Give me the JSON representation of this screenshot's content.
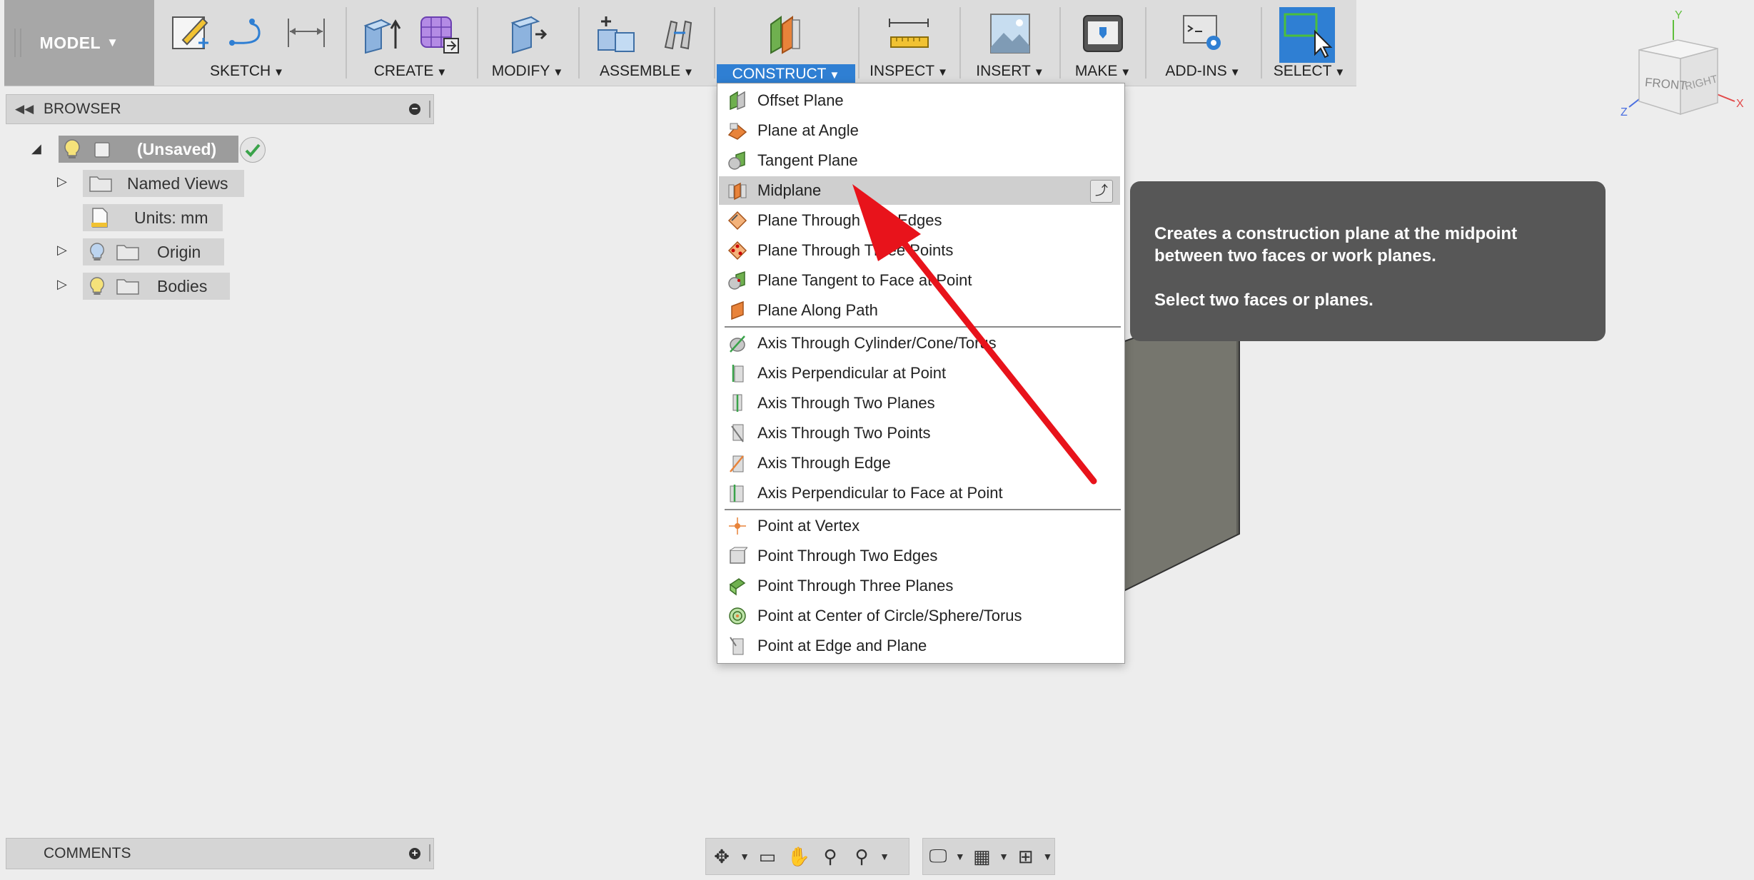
{
  "toolbar": {
    "model_label": "MODEL",
    "groups": [
      {
        "label": "SKETCH"
      },
      {
        "label": "CREATE"
      },
      {
        "label": "MODIFY"
      },
      {
        "label": "ASSEMBLE"
      },
      {
        "label": "CONSTRUCT"
      },
      {
        "label": "INSPECT"
      },
      {
        "label": "INSERT"
      },
      {
        "label": "MAKE"
      },
      {
        "label": "ADD-INS"
      },
      {
        "label": "SELECT"
      }
    ],
    "caret": "▼"
  },
  "browser": {
    "title": "BROWSER",
    "root": "(Unsaved)",
    "items": [
      {
        "label": "Named Views"
      },
      {
        "label": "Units: mm"
      },
      {
        "label": "Origin"
      },
      {
        "label": "Bodies"
      }
    ]
  },
  "construct_menu": {
    "items": [
      {
        "label": "Offset Plane",
        "icon": "offset-plane-icon"
      },
      {
        "label": "Plane at Angle",
        "icon": "plane-at-angle-icon"
      },
      {
        "label": "Tangent Plane",
        "icon": "tangent-plane-icon"
      },
      {
        "label": "Midplane",
        "icon": "midplane-icon",
        "highlighted": true
      },
      {
        "label": "Plane Through Two Edges",
        "icon": "plane-two-edges-icon"
      },
      {
        "label": "Plane Through Three Points",
        "icon": "plane-three-points-icon"
      },
      {
        "label": "Plane Tangent to Face at Point",
        "icon": "plane-tangent-face-icon"
      },
      {
        "label": "Plane Along Path",
        "icon": "plane-along-path-icon"
      },
      {
        "label": "Axis Through Cylinder/Cone/Torus",
        "icon": "axis-cylinder-icon"
      },
      {
        "label": "Axis Perpendicular at Point",
        "icon": "axis-perpendicular-point-icon"
      },
      {
        "label": "Axis Through Two Planes",
        "icon": "axis-two-planes-icon"
      },
      {
        "label": "Axis Through Two Points",
        "icon": "axis-two-points-icon"
      },
      {
        "label": "Axis Through Edge",
        "icon": "axis-edge-icon"
      },
      {
        "label": "Axis Perpendicular to Face at Point",
        "icon": "axis-perp-face-icon"
      },
      {
        "label": "Point at Vertex",
        "icon": "point-vertex-icon"
      },
      {
        "label": "Point Through Two Edges",
        "icon": "point-two-edges-icon"
      },
      {
        "label": "Point Through Three Planes",
        "icon": "point-three-planes-icon"
      },
      {
        "label": "Point at Center of Circle/Sphere/Torus",
        "icon": "point-center-icon"
      },
      {
        "label": "Point at Edge and Plane",
        "icon": "point-edge-plane-icon"
      }
    ]
  },
  "tooltip": {
    "line1": "Creates a construction plane at the midpoint",
    "line2": "between two faces or work planes.",
    "line3": "Select two faces or planes."
  },
  "comments": {
    "title": "COMMENTS"
  },
  "viewcube": {
    "front": "FRONT",
    "right": "RIGHT",
    "axis_x": "X",
    "axis_y": "Y",
    "axis_z": "Z"
  },
  "colors": {
    "accent": "#2f7fd3",
    "arrow": "#e8131b",
    "tooltip_bg": "#575757",
    "box": "#77776f"
  }
}
